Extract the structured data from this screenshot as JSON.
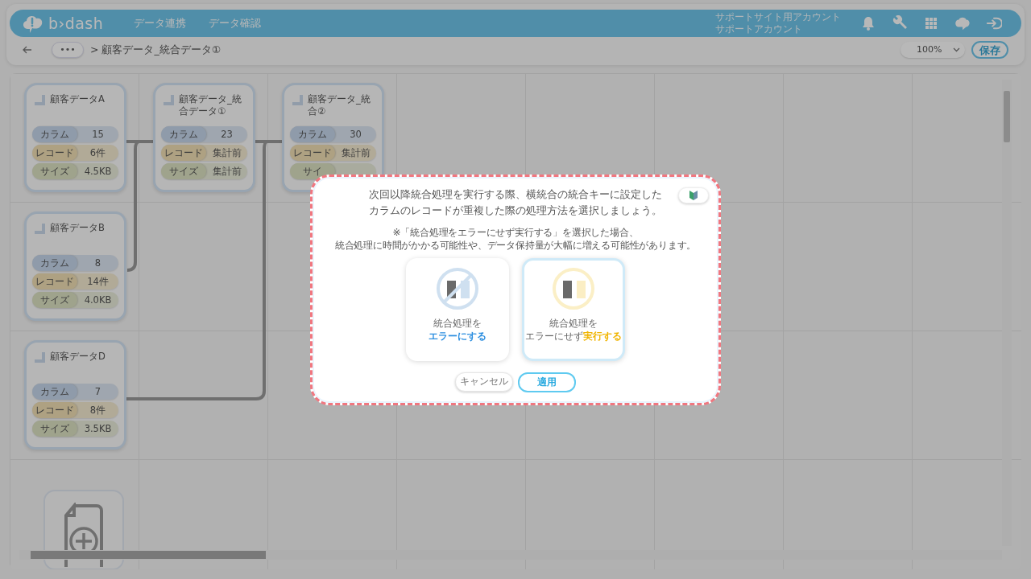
{
  "header": {
    "logo": "b›dash",
    "menu": [
      {
        "label": "データ連携"
      },
      {
        "label": "データ確認"
      }
    ],
    "account": {
      "site": "サポートサイト用アカウント",
      "name": "サポートアカウント"
    }
  },
  "toolbar": {
    "more": "•••",
    "breadcrumb": "> 顧客データ_統合データ①",
    "zoom": "100%",
    "save": "保存"
  },
  "nodes": [
    {
      "title": "顧客データA",
      "stats": [
        {
          "kind": "column",
          "label": "カラム",
          "value": "15"
        },
        {
          "kind": "record",
          "label": "レコード",
          "value": "6件"
        },
        {
          "kind": "size",
          "label": "サイズ",
          "value": "4.5KB"
        }
      ]
    },
    {
      "title": "顧客データ_統合データ①",
      "stats": [
        {
          "kind": "column",
          "label": "カラム",
          "value": "23"
        },
        {
          "kind": "record",
          "label": "レコード",
          "value": "集計前"
        },
        {
          "kind": "size",
          "label": "サイズ",
          "value": "集計前"
        }
      ]
    },
    {
      "title": "顧客データ_統合②",
      "stats": [
        {
          "kind": "column",
          "label": "カラム",
          "value": "30"
        },
        {
          "kind": "record",
          "label": "レコード",
          "value": "集計前"
        },
        {
          "kind": "size",
          "label": "サイ"
        }
      ]
    },
    {
      "title": "顧客データB",
      "stats": [
        {
          "kind": "column",
          "label": "カラム",
          "value": "8"
        },
        {
          "kind": "record",
          "label": "レコード",
          "value": "14件"
        },
        {
          "kind": "size",
          "label": "サイズ",
          "value": "4.0KB"
        }
      ]
    },
    {
      "title": "顧客データD",
      "stats": [
        {
          "kind": "column",
          "label": "カラム",
          "value": "7"
        },
        {
          "kind": "record",
          "label": "レコード",
          "value": "8件"
        },
        {
          "kind": "size",
          "label": "サイズ",
          "value": "3.5KB"
        }
      ]
    }
  ],
  "dialog": {
    "message": [
      "次回以降統合処理を実行する際、横統合の統合キーに設定した",
      "カラムのレコードが重複した際の処理方法を選択しましょう。"
    ],
    "note": [
      "※「統合処理をエラーにせず実行する」を選択した場合、",
      "統合処理に時間がかかる可能性や、データ保持量が大幅に増える可能性があります。"
    ],
    "options": [
      {
        "kind": "error",
        "title": "統合処理を",
        "action": "エラーにする",
        "selected": false
      },
      {
        "kind": "run",
        "title": "統合処理を",
        "action_prefix": "エラーにせず",
        "action": "実行する",
        "selected": true
      }
    ],
    "cancel": "キャンセル",
    "apply": "適用"
  }
}
